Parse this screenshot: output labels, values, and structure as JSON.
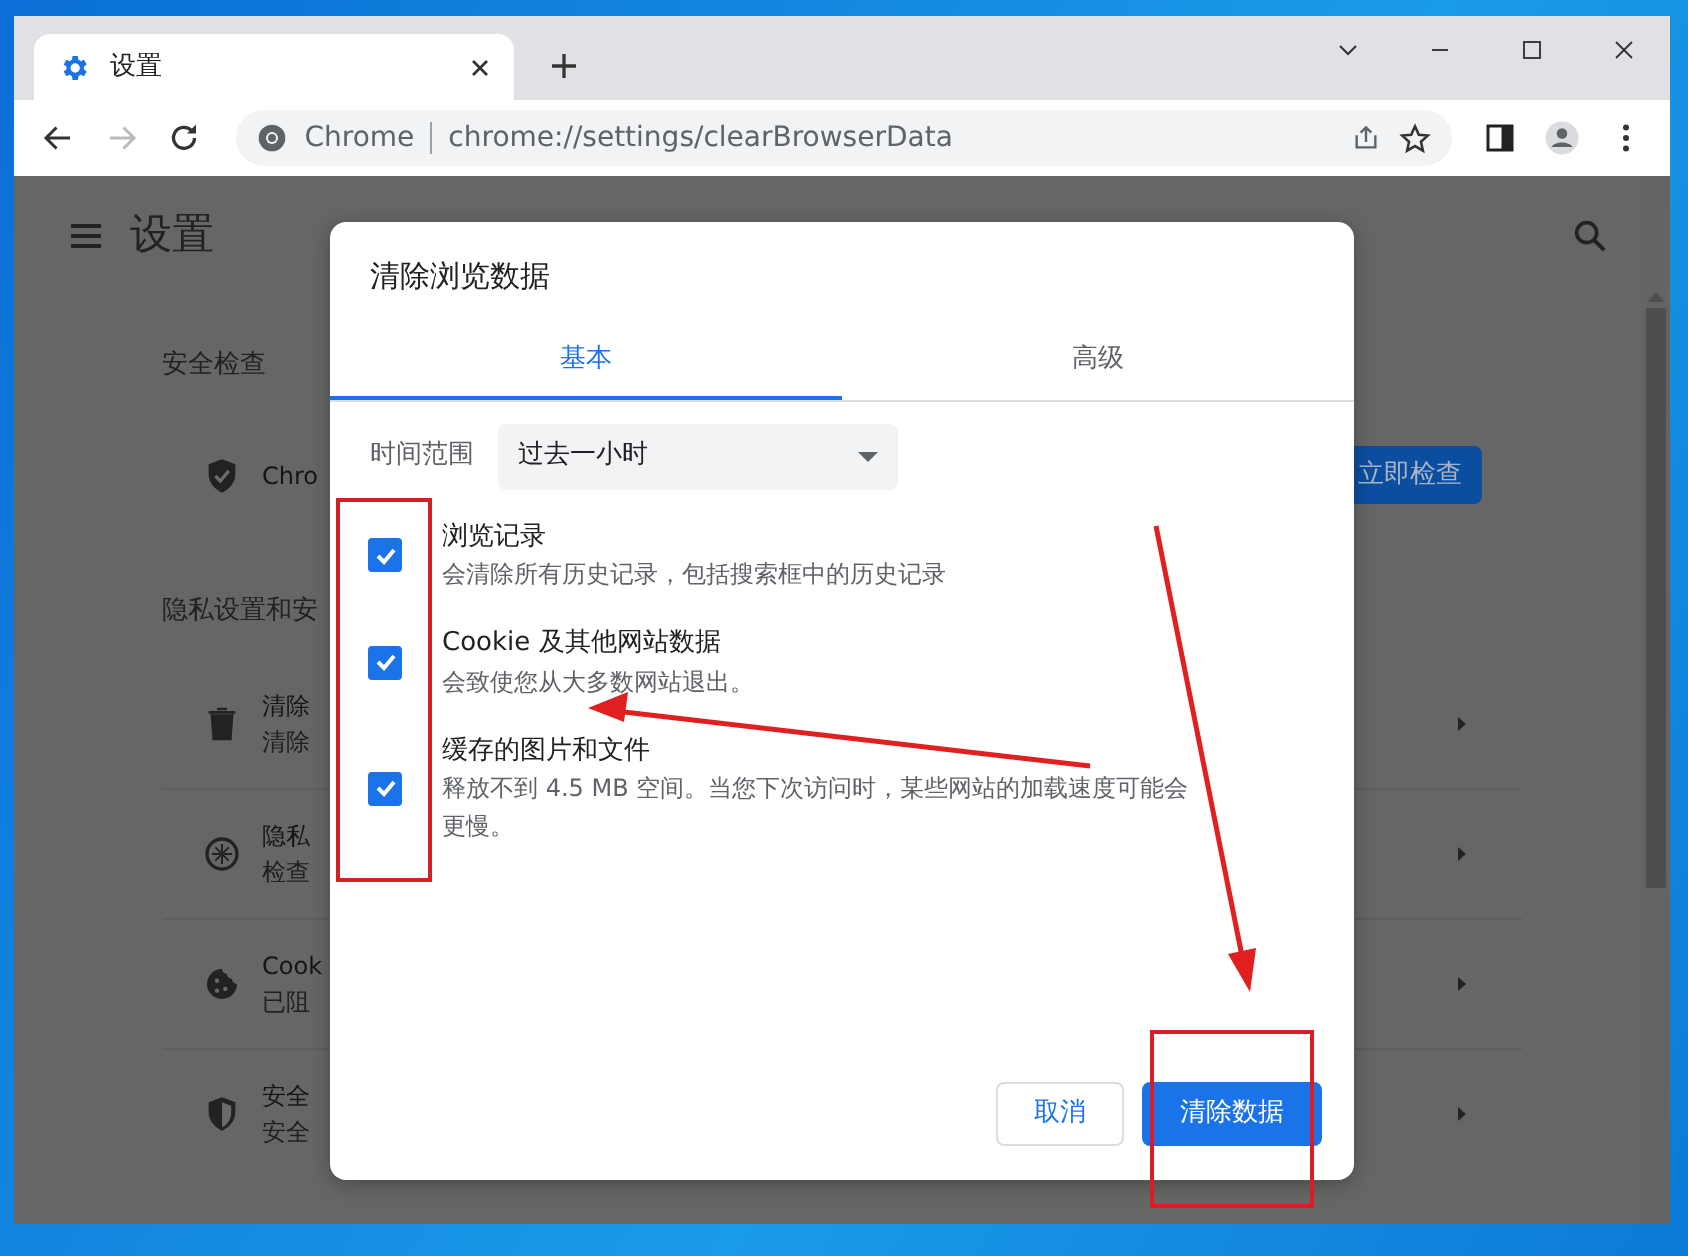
{
  "browser": {
    "tab": {
      "title": "设置"
    },
    "omnibox": {
      "site_label": "Chrome",
      "url": "chrome://settings/clearBrowserData"
    }
  },
  "settings_page": {
    "title": "设置",
    "sections": [
      {
        "heading": "安全检查",
        "rows": [
          {
            "kind": "action",
            "title": "Chro",
            "button": "立即检查"
          }
        ]
      },
      {
        "heading": "隐私设置和安",
        "rows": [
          {
            "kind": "link",
            "title": "清除",
            "subtitle": "清除"
          },
          {
            "kind": "link",
            "title": "隐私",
            "subtitle": "检查"
          },
          {
            "kind": "link",
            "title": "Cook",
            "subtitle": "已阻"
          },
          {
            "kind": "link",
            "title": "安全",
            "subtitle": "安全"
          }
        ]
      }
    ]
  },
  "dialog": {
    "title": "清除浏览数据",
    "tabs": [
      {
        "label": "基本",
        "selected": true
      },
      {
        "label": "高级",
        "selected": false
      }
    ],
    "time_range": {
      "label": "时间范围",
      "value": "过去一小时"
    },
    "items": [
      {
        "label": "浏览记录",
        "description": "会清除所有历史记录，包括搜索框中的历史记录",
        "checked": true
      },
      {
        "label": "Cookie 及其他网站数据",
        "description": "会致使您从大多数网站退出。",
        "checked": true
      },
      {
        "label": "缓存的图片和文件",
        "description": "释放不到 4.5 MB 空间。当您下次访问时，某些网站的加载速度可能会更慢。",
        "checked": true
      }
    ],
    "buttons": [
      {
        "label": "取消",
        "kind": "secondary"
      },
      {
        "label": "清除数据",
        "kind": "primary"
      }
    ]
  }
}
